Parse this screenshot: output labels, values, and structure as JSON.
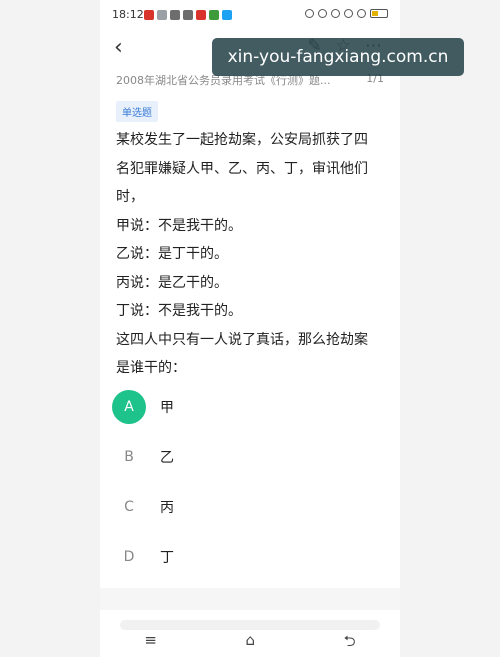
{
  "status_bar": {
    "time": "18:12",
    "notification_colors": [
      "#d9342b",
      "#9aa0a6",
      "#6d6d6d",
      "#6d6d6d",
      "#d9342b",
      "#3f9b3a",
      "#1da1f2"
    ],
    "system_icons": [
      "alarm-icon",
      "mute-icon",
      "nfc-icon",
      "signal-icon",
      "wifi-icon",
      "battery-icon"
    ]
  },
  "nav": {
    "back_icon": "‹",
    "edit_icon": "✎",
    "star_icon": "☆",
    "more_icon": "⋯"
  },
  "header": {
    "subtitle": "2008年湖北省公务员录用考试《行测》题...",
    "counter": "1/1"
  },
  "question": {
    "tag": "单选题",
    "lines": [
      "某校发生了一起抢劫案，公安局抓获了四",
      "名犯罪嫌疑人甲、乙、丙、丁，审讯他们",
      "时，",
      "甲说：不是我干的。",
      "乙说：是丁干的。",
      "丙说：是乙干的。",
      "丁说：不是我干的。",
      "这四人中只有一人说了真话，那么抢劫案",
      "是谁干的："
    ]
  },
  "options": [
    {
      "letter": "A",
      "text": "甲",
      "selected": true
    },
    {
      "letter": "B",
      "text": "乙",
      "selected": false
    },
    {
      "letter": "C",
      "text": "丙",
      "selected": false
    },
    {
      "letter": "D",
      "text": "丁",
      "selected": false
    }
  ],
  "system_nav": {
    "menu_icon": "≡",
    "home_icon": "⌂",
    "back_icon": "⮌"
  },
  "watermark": {
    "text": "xin-you-fangxiang.com.cn"
  },
  "colors": {
    "selected_option": "#1ec28b",
    "tag_background": "#e7f0fb",
    "tag_text": "#3b7bd6"
  }
}
